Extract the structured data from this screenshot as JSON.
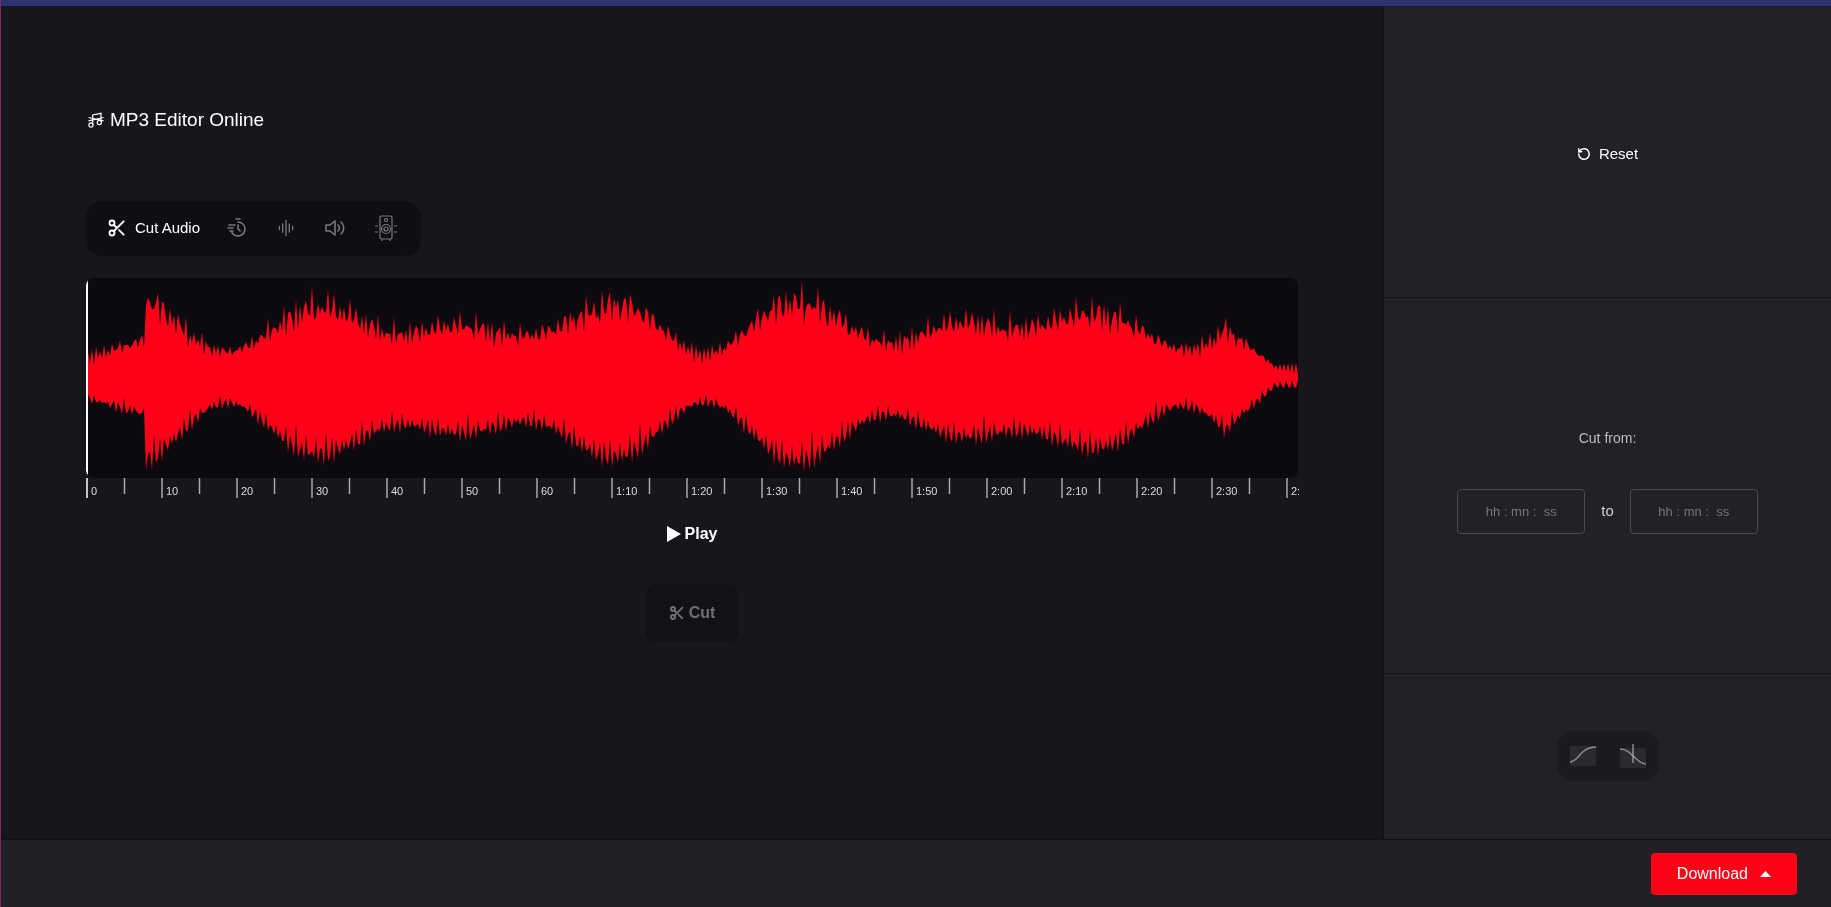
{
  "title": "MP3 Editor Online",
  "tools": [
    {
      "kind": "cut",
      "label": "Cut Audio",
      "selected": true
    },
    {
      "kind": "speed",
      "selected": false
    },
    {
      "kind": "waveform",
      "selected": false
    },
    {
      "kind": "volume",
      "selected": false
    },
    {
      "kind": "speaker",
      "selected": false
    }
  ],
  "timeline": {
    "labels": [
      "0",
      "10",
      "20",
      "30",
      "40",
      "50",
      "60",
      "1:10",
      "1:20",
      "1:30",
      "1:40",
      "1:50",
      "2:00",
      "2:10",
      "2:20",
      "2:30",
      "2:"
    ]
  },
  "play_button": {
    "label": "Play"
  },
  "cut_button": {
    "label": "Cut",
    "disabled": true
  },
  "reset_button": {
    "label": "Reset"
  },
  "cut_range": {
    "label": "Cut from:",
    "from": {
      "placeholder": "hh : mn :  ss"
    },
    "separator": "to",
    "to": {
      "placeholder": "hh : mn :  ss"
    }
  },
  "fades": [
    {
      "kind": "fade-in"
    },
    {
      "kind": "fade-out"
    }
  ],
  "download_button": {
    "label": "Download"
  }
}
